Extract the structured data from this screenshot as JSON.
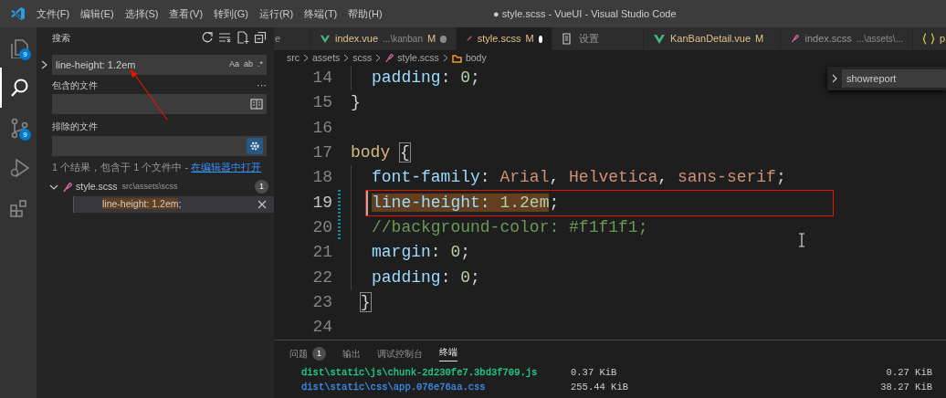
{
  "window": {
    "title": "● style.scss - VueUI - Visual Studio Code"
  },
  "menu": [
    "文件(F)",
    "编辑(E)",
    "选择(S)",
    "查看(V)",
    "转到(G)",
    "运行(R)",
    "终端(T)",
    "帮助(H)"
  ],
  "activity_bar": [
    {
      "kind": "files",
      "badge": "9",
      "selected": false
    },
    {
      "kind": "search",
      "selected": true
    },
    {
      "kind": "source-control",
      "badge": "9",
      "selected": false
    },
    {
      "kind": "debug",
      "selected": false
    },
    {
      "kind": "extensions",
      "selected": false
    }
  ],
  "sidebar": {
    "title": "搜索",
    "search": {
      "value": "line-height: 1.2em",
      "options": [
        "Aa",
        "ab",
        ".*"
      ]
    },
    "include": {
      "label": "包含的文件",
      "more": "···"
    },
    "exclude": {
      "label": "排除的文件",
      "use_exclude_settings": true
    },
    "message": "1 个结果，包含于 1 个文件中 - ",
    "open_link": "在编辑器中打开",
    "results": [
      {
        "file": "style.scss",
        "path": "src\\assets\\scss",
        "count": "1",
        "expanded": true,
        "children": [
          {
            "match": "line-height: 1.2em",
            "rest": ";",
            "selected": true
          }
        ]
      }
    ]
  },
  "tabs": [
    {
      "kind": "unknown",
      "label": "e",
      "selected": false
    },
    {
      "kind": "vue",
      "label": "index.vue",
      "path": "...\\kanban",
      "status": "M",
      "dirty": true,
      "selected": false
    },
    {
      "kind": "scss",
      "label": "style.scss",
      "status": "M",
      "dirty": true,
      "selected": true
    },
    {
      "kind": "settings",
      "label": "设置",
      "selected": false
    },
    {
      "kind": "vue",
      "label": "KanBanDetail.vue",
      "status": "M",
      "selected": false
    },
    {
      "kind": "scss",
      "label": "index.scss",
      "path": "...\\assets\\...",
      "selected": false
    },
    {
      "kind": "json",
      "label": "p",
      "selected": false
    }
  ],
  "breadcrumb": [
    "src",
    "assets",
    "scss",
    "style.scss",
    "body"
  ],
  "find_widget": {
    "value": "showreport"
  },
  "code": [
    {
      "number": "14",
      "kind": "declaration",
      "tokens": [
        {
          "kind": "property",
          "text": "padding"
        },
        {
          "kind": "punct",
          "text": ": "
        },
        {
          "kind": "number",
          "text": "0"
        },
        {
          "kind": "punct",
          "text": ";"
        }
      ]
    },
    {
      "number": "15",
      "kind": "close",
      "tokens": [
        {
          "kind": "punct",
          "text": "}"
        }
      ]
    },
    {
      "number": "16",
      "kind": "blank"
    },
    {
      "number": "17",
      "kind": "open",
      "tokens": [
        {
          "kind": "selector",
          "text": "body"
        },
        {
          "kind": "punct",
          "text": "{",
          "bracket_match": true
        }
      ]
    },
    {
      "number": "18",
      "kind": "declaration",
      "tokens": [
        {
          "kind": "property",
          "text": "font-family"
        },
        {
          "kind": "punct",
          "text": ": "
        },
        {
          "kind": "string",
          "text": "Arial"
        },
        {
          "kind": "punct",
          "text": ", "
        },
        {
          "kind": "string",
          "text": "Helvetica"
        },
        {
          "kind": "punct",
          "text": ", "
        },
        {
          "kind": "string",
          "text": "sans-serif"
        },
        {
          "kind": "punct",
          "text": ";"
        }
      ]
    },
    {
      "number": "19",
      "kind": "declaration",
      "current": true,
      "modified": true,
      "tokens": [
        {
          "kind": "property",
          "text": "line-height",
          "match": true
        },
        {
          "kind": "punct",
          "text": ": ",
          "match": true
        },
        {
          "kind": "number",
          "text": "1.2em",
          "match": true
        },
        {
          "kind": "punct",
          "text": ";"
        }
      ]
    },
    {
      "number": "20",
      "kind": "declaration",
      "modified": true,
      "tokens": [
        {
          "kind": "comment",
          "text": "//background-color: #f1f1f1;"
        }
      ]
    },
    {
      "number": "21",
      "kind": "declaration",
      "tokens": [
        {
          "kind": "property",
          "text": "margin"
        },
        {
          "kind": "punct",
          "text": ": "
        },
        {
          "kind": "number",
          "text": "0"
        },
        {
          "kind": "punct",
          "text": ";"
        }
      ]
    },
    {
      "number": "22",
      "kind": "declaration",
      "tokens": [
        {
          "kind": "property",
          "text": "padding"
        },
        {
          "kind": "punct",
          "text": ": "
        },
        {
          "kind": "number",
          "text": "0"
        },
        {
          "kind": "punct",
          "text": ";"
        }
      ]
    },
    {
      "number": "23",
      "kind": "close",
      "tokens": [
        {
          "kind": "punct",
          "text": "}",
          "bracket_match": true
        }
      ]
    },
    {
      "number": "24",
      "kind": "blank"
    }
  ],
  "panel": {
    "tabs": [
      {
        "label": "问题",
        "badge": "1",
        "selected": false
      },
      {
        "label": "输出",
        "selected": false
      },
      {
        "label": "调试控制台",
        "selected": false
      },
      {
        "label": "终端",
        "selected": true
      }
    ],
    "terminal": [
      {
        "file": "dist\\static\\js\\chunk-2d230fe7.3bd3f709.js",
        "size": "0.37 KiB",
        "gzipped": "0.27 KiB",
        "color": "#23d18b"
      },
      {
        "file": "dist\\static\\css\\app.076e76aa.css",
        "size": "255.44 KiB",
        "gzipped": "38.27 KiB",
        "color": "#3b8eea"
      }
    ]
  }
}
